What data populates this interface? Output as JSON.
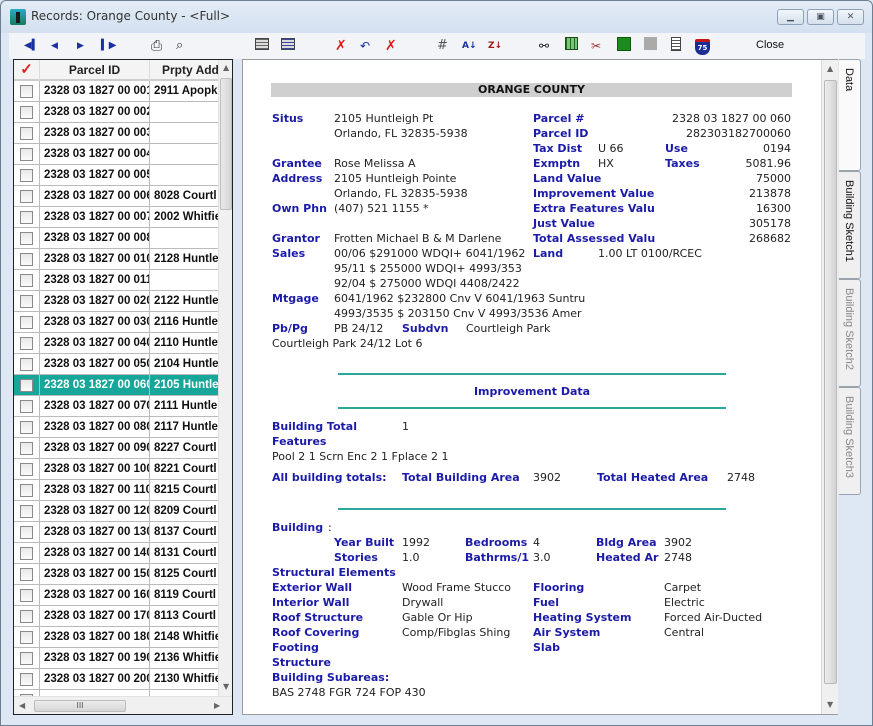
{
  "window": {
    "title": "Records: Orange County - <Full>",
    "controls": [
      "minimize",
      "restore",
      "close"
    ]
  },
  "toolbar": {
    "buttons": [
      {
        "name": "first-record",
        "icon": "first-icon",
        "glyph": "⏮"
      },
      {
        "name": "previous-record",
        "icon": "previous-icon",
        "glyph": "◀"
      },
      {
        "name": "next-record",
        "icon": "next-icon",
        "glyph": "▶"
      },
      {
        "name": "last-record",
        "icon": "last-icon",
        "glyph": "⏭"
      },
      {
        "name": "print",
        "icon": "printer-icon",
        "glyph": "🖶"
      },
      {
        "name": "print-preview",
        "icon": "print-preview-icon",
        "glyph": "🔍"
      },
      {
        "name": "form-view",
        "icon": "form-view-icon",
        "glyph": "▤"
      },
      {
        "name": "table-view",
        "icon": "table-view-icon",
        "glyph": "▦"
      },
      {
        "name": "delete-record",
        "icon": "delete-icon",
        "glyph": "✗"
      },
      {
        "name": "undo",
        "icon": "undo-icon",
        "glyph": "↶"
      },
      {
        "name": "delete-all",
        "icon": "delete-all-icon",
        "glyph": "✗"
      },
      {
        "name": "grid",
        "icon": "grid-icon",
        "glyph": "#"
      },
      {
        "name": "sort-ascending",
        "icon": "sort-az-icon",
        "glyph": "A↓"
      },
      {
        "name": "sort-descending",
        "icon": "sort-za-icon",
        "glyph": "Z↓"
      },
      {
        "name": "find",
        "icon": "binoculars-icon",
        "glyph": "⚲"
      },
      {
        "name": "spreadsheet",
        "icon": "spreadsheet-icon",
        "glyph": "▦"
      },
      {
        "name": "tools",
        "icon": "tools-icon",
        "glyph": "✂"
      },
      {
        "name": "map",
        "icon": "map-icon",
        "glyph": "◼"
      },
      {
        "name": "disabled-action",
        "icon": "blank-icon",
        "glyph": "◼"
      },
      {
        "name": "report",
        "icon": "report-icon",
        "glyph": "▤"
      },
      {
        "name": "interstate",
        "icon": "interstate-75-icon",
        "glyph": "75"
      }
    ],
    "close_label": "Close"
  },
  "grid": {
    "columns": {
      "check": "✓",
      "parcel_id": "Parcel ID",
      "address": "Prpty Add"
    },
    "rows": [
      {
        "parcel_id": "2328 03 1827 00 001",
        "address": "2911 Apopk",
        "selected": false
      },
      {
        "parcel_id": "2328 03 1827 00 002",
        "address": "",
        "selected": false
      },
      {
        "parcel_id": "2328 03 1827 00 003",
        "address": "",
        "selected": false
      },
      {
        "parcel_id": "2328 03 1827 00 004",
        "address": "",
        "selected": false
      },
      {
        "parcel_id": "2328 03 1827 00 005",
        "address": "",
        "selected": false
      },
      {
        "parcel_id": "2328 03 1827 00 006",
        "address": "8028 Courtl",
        "selected": false
      },
      {
        "parcel_id": "2328 03 1827 00 007",
        "address": "2002 Whitfie",
        "selected": false
      },
      {
        "parcel_id": "2328 03 1827 00 008",
        "address": "",
        "selected": false
      },
      {
        "parcel_id": "2328 03 1827 00 010",
        "address": "2128 Huntle",
        "selected": false
      },
      {
        "parcel_id": "2328 03 1827 00 011",
        "address": "",
        "selected": false
      },
      {
        "parcel_id": "2328 03 1827 00 020",
        "address": "2122 Huntle",
        "selected": false
      },
      {
        "parcel_id": "2328 03 1827 00 030",
        "address": "2116 Huntle",
        "selected": false
      },
      {
        "parcel_id": "2328 03 1827 00 040",
        "address": "2110 Huntle",
        "selected": false
      },
      {
        "parcel_id": "2328 03 1827 00 050",
        "address": "2104 Huntle",
        "selected": false
      },
      {
        "parcel_id": "2328 03 1827 00 060",
        "address": "2105 Huntle",
        "selected": true
      },
      {
        "parcel_id": "2328 03 1827 00 070",
        "address": "2111 Huntle",
        "selected": false
      },
      {
        "parcel_id": "2328 03 1827 00 080",
        "address": "2117 Huntle",
        "selected": false
      },
      {
        "parcel_id": "2328 03 1827 00 090",
        "address": "8227 Courtl",
        "selected": false
      },
      {
        "parcel_id": "2328 03 1827 00 100",
        "address": "8221 Courtl",
        "selected": false
      },
      {
        "parcel_id": "2328 03 1827 00 110",
        "address": "8215 Courtl",
        "selected": false
      },
      {
        "parcel_id": "2328 03 1827 00 120",
        "address": "8209 Courtl",
        "selected": false
      },
      {
        "parcel_id": "2328 03 1827 00 130",
        "address": "8137 Courtl",
        "selected": false
      },
      {
        "parcel_id": "2328 03 1827 00 140",
        "address": "8131 Courtl",
        "selected": false
      },
      {
        "parcel_id": "2328 03 1827 00 150",
        "address": "8125 Courtl",
        "selected": false
      },
      {
        "parcel_id": "2328 03 1827 00 160",
        "address": "8119 Courtl",
        "selected": false
      },
      {
        "parcel_id": "2328 03 1827 00 170",
        "address": "8113 Courtl",
        "selected": false
      },
      {
        "parcel_id": "2328 03 1827 00 180",
        "address": "2148 Whitfie",
        "selected": false
      },
      {
        "parcel_id": "2328 03 1827 00 190",
        "address": "2136 Whitfie",
        "selected": false
      },
      {
        "parcel_id": "2328 03 1827 00 200",
        "address": "2130 Whitfie",
        "selected": false
      },
      {
        "parcel_id": "",
        "address": "",
        "selected": false
      }
    ]
  },
  "record": {
    "county": "ORANGE COUNTY",
    "situs_label": "Situs",
    "situs_line1": "2105 Huntleigh Pt",
    "situs_line2": "Orlando, FL 32835-5938",
    "grantee_label": "Grantee",
    "grantee": "Rose Melissa A",
    "address_label": "Address",
    "address_line1": "2105 Huntleigh Pointe",
    "address_line2": "Orlando, FL 32835-5938",
    "phone_label": "Own Phn",
    "phone": "(407) 521 1155 *",
    "grantor_label": "Grantor",
    "grantor": "Frotten Michael B & M Darlene",
    "sales_label": "Sales",
    "sales": [
      "00/06 $291000 WDQI+ 6041/1962",
      "95/11 $ 255000 WDQI+ 4993/353",
      "92/04 $ 275000 WDQI 4408/2422"
    ],
    "mtgage_label": "Mtgage",
    "mtgage": [
      "6041/1962 $232800 Cnv V 6041/1963 Suntru",
      "4993/3535 $ 203150 Cnv V 4993/3536 Amer"
    ],
    "pbpg_label": "Pb/Pg",
    "pbpg": "PB 24/12",
    "subdvn_label": "Subdvn",
    "subdvn": "Courtleigh Park",
    "legal": "Courtleigh Park 24/12 Lot 6",
    "parcel_num_label": "Parcel #",
    "parcel_num": "2328 03 1827 00 060",
    "parcel_id_label": "Parcel ID",
    "parcel_id": "282303182700060",
    "tax_dist_label": "Tax Dist",
    "tax_dist": "U 66",
    "use_label": "Use",
    "use": "0194",
    "exmptn_label": "Exmptn",
    "exmptn": "HX",
    "taxes_label": "Taxes",
    "taxes": "5081.96",
    "land_value_label": "Land Value",
    "land_value": "75000",
    "improvement_value_label": "Improvement Value",
    "improvement_value": "213878",
    "extra_features_label": "Extra Features Valu",
    "extra_features": "16300",
    "just_value_label": "Just Value",
    "just_value": "305178",
    "total_assessed_label": "Total Assessed Valu",
    "total_assessed": "268682",
    "land_label": "Land",
    "land": "1.00 LT 0100/RCEC"
  },
  "improvement": {
    "heading": "Improvement Data",
    "building_total_label": "Building Total",
    "building_total": "1",
    "features_label": "Features",
    "features": "Pool 2 1 Scrn Enc 2 1 Fplace 2 1",
    "all_totals_label": "All building totals:",
    "total_building_area_label": "Total Building Area",
    "total_building_area": "3902",
    "total_heated_area_label": "Total Heated Area",
    "total_heated_area": "2748",
    "building_label": "Building",
    "building_colon": ":",
    "year_built_label": "Year Built",
    "year_built": "1992",
    "bedrooms_label": "Bedrooms",
    "bedrooms": "4",
    "bldg_area_label": "Bldg Area",
    "bldg_area": "3902",
    "stories_label": "Stories",
    "stories": "1.0",
    "bathrooms_label": "Bathrms/1",
    "bathrooms": "3.0",
    "heated_area_label": "Heated Ar",
    "heated_area": "2748",
    "structural_label": "Structural Elements",
    "elements_left": [
      {
        "label": "Exterior Wall",
        "value": "Wood Frame Stucco"
      },
      {
        "label": "Interior Wall",
        "value": "Drywall"
      },
      {
        "label": "Roof Structure",
        "value": "Gable Or Hip"
      },
      {
        "label": "Roof Covering",
        "value": "Comp/Fibglas Shing"
      },
      {
        "label": "Footing",
        "value": ""
      },
      {
        "label": "Structure",
        "value": ""
      }
    ],
    "elements_right": [
      {
        "label": "Flooring",
        "value": "Carpet"
      },
      {
        "label": "Fuel",
        "value": "Electric"
      },
      {
        "label": "Heating System",
        "value": "Forced Air-Ducted"
      },
      {
        "label": "Air System",
        "value": "Central"
      },
      {
        "label": "Slab",
        "value": ""
      }
    ],
    "subareas_label": "Building Subareas:",
    "subareas": "BAS 2748 FGR 724 FOP 430"
  },
  "tabs": [
    {
      "label": "Data",
      "active": true,
      "enabled": true
    },
    {
      "label": "Building Sketch1",
      "active": false,
      "enabled": true
    },
    {
      "label": "Building Sketch2",
      "active": false,
      "enabled": false
    },
    {
      "label": "Building Sketch3",
      "active": false,
      "enabled": false
    }
  ]
}
